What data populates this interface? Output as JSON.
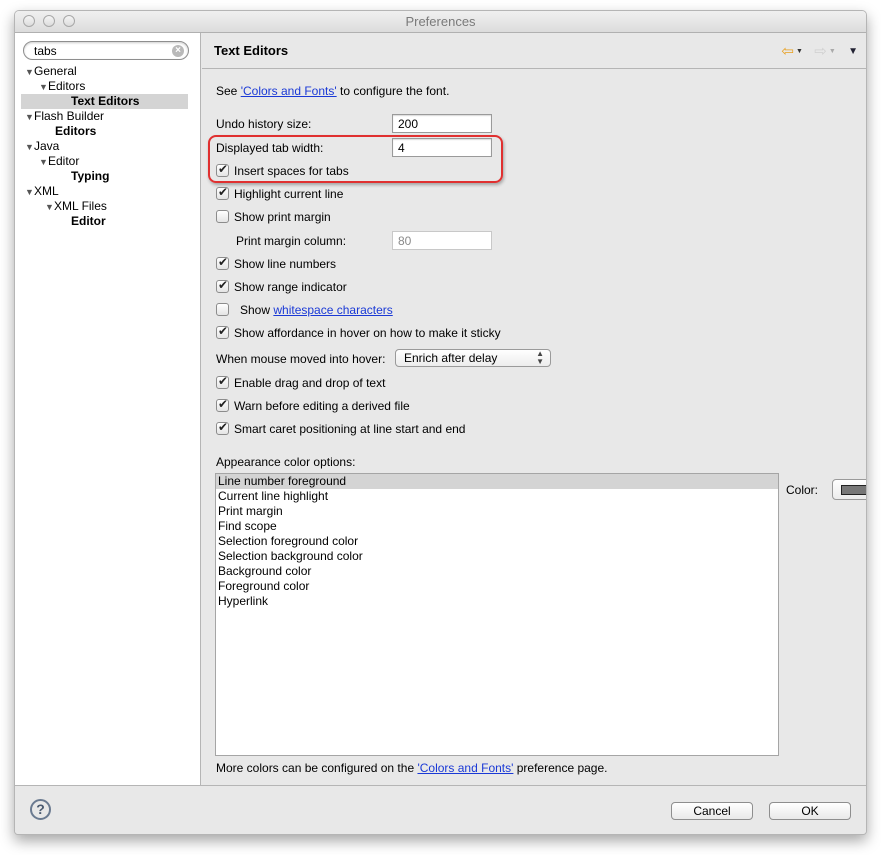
{
  "window": {
    "title": "Preferences"
  },
  "sidebar": {
    "search": {
      "value": "tabs"
    },
    "tree": [
      {
        "label": "General",
        "level": 0,
        "expanded": true,
        "bold": false
      },
      {
        "label": "Editors",
        "level": 1,
        "expanded": true,
        "bold": false
      },
      {
        "label": "Text Editors",
        "level": 2,
        "bold": true,
        "selected": true
      },
      {
        "label": "Flash Builder",
        "level": 0,
        "expanded": true,
        "bold": false
      },
      {
        "label": "Editors",
        "level": 1,
        "bold": true
      },
      {
        "label": "Java",
        "level": 0,
        "expanded": true,
        "bold": false
      },
      {
        "label": "Editor",
        "level": 1,
        "expanded": true,
        "bold": false
      },
      {
        "label": "Typing",
        "level": 2,
        "bold": true
      },
      {
        "label": "XML",
        "level": 0,
        "expanded": true,
        "bold": false
      },
      {
        "label": "XML Files",
        "level": 1,
        "expanded": true,
        "bold": false
      },
      {
        "label": "Editor",
        "level": 2,
        "bold": true
      }
    ]
  },
  "page": {
    "title": "Text Editors",
    "intro_prefix": "See ",
    "intro_link": "'Colors and Fonts'",
    "intro_suffix": " to configure the font.",
    "undo_label": "Undo history size:",
    "undo_value": "200",
    "tab_width_label": "Displayed tab width:",
    "tab_width_value": "4",
    "insert_spaces": {
      "label": "Insert spaces for tabs",
      "checked": true
    },
    "highlight_line": {
      "label": "Highlight current line",
      "checked": true
    },
    "show_print_margin": {
      "label": "Show print margin",
      "checked": false
    },
    "print_margin_label": "Print margin column:",
    "print_margin_value": "80",
    "show_line_numbers": {
      "label": "Show line numbers",
      "checked": true
    },
    "show_range": {
      "label": "Show range indicator",
      "checked": true
    },
    "show_whitespace": {
      "prefix": "Show ",
      "link": "whitespace characters",
      "checked": false
    },
    "show_affordance": {
      "label": "Show affordance in hover on how to make it sticky",
      "checked": true
    },
    "hover_label": "When mouse moved into hover:",
    "hover_value": "Enrich after delay",
    "drag_drop": {
      "label": "Enable drag and drop of text",
      "checked": true
    },
    "warn_derived": {
      "label": "Warn before editing a derived file",
      "checked": true
    },
    "smart_caret": {
      "label": "Smart caret positioning at line start and end",
      "checked": true
    },
    "appearance_label": "Appearance color options:",
    "appearance_items": [
      "Line number foreground",
      "Current line highlight",
      "Print margin",
      "Find scope",
      "Selection foreground color",
      "Selection background color",
      "Background color",
      "Foreground color",
      "Hyperlink"
    ],
    "color_label": "Color:",
    "color_value": "#777777",
    "footer_prefix": "More colors can be configured on the ",
    "footer_link": "'Colors and Fonts'",
    "footer_suffix": " preference page."
  },
  "buttons": {
    "cancel": "Cancel",
    "ok": "OK",
    "help": "?"
  },
  "icons": {
    "back": "back-arrow-icon",
    "forward": "forward-arrow-icon",
    "view_menu": "view-menu-icon"
  }
}
